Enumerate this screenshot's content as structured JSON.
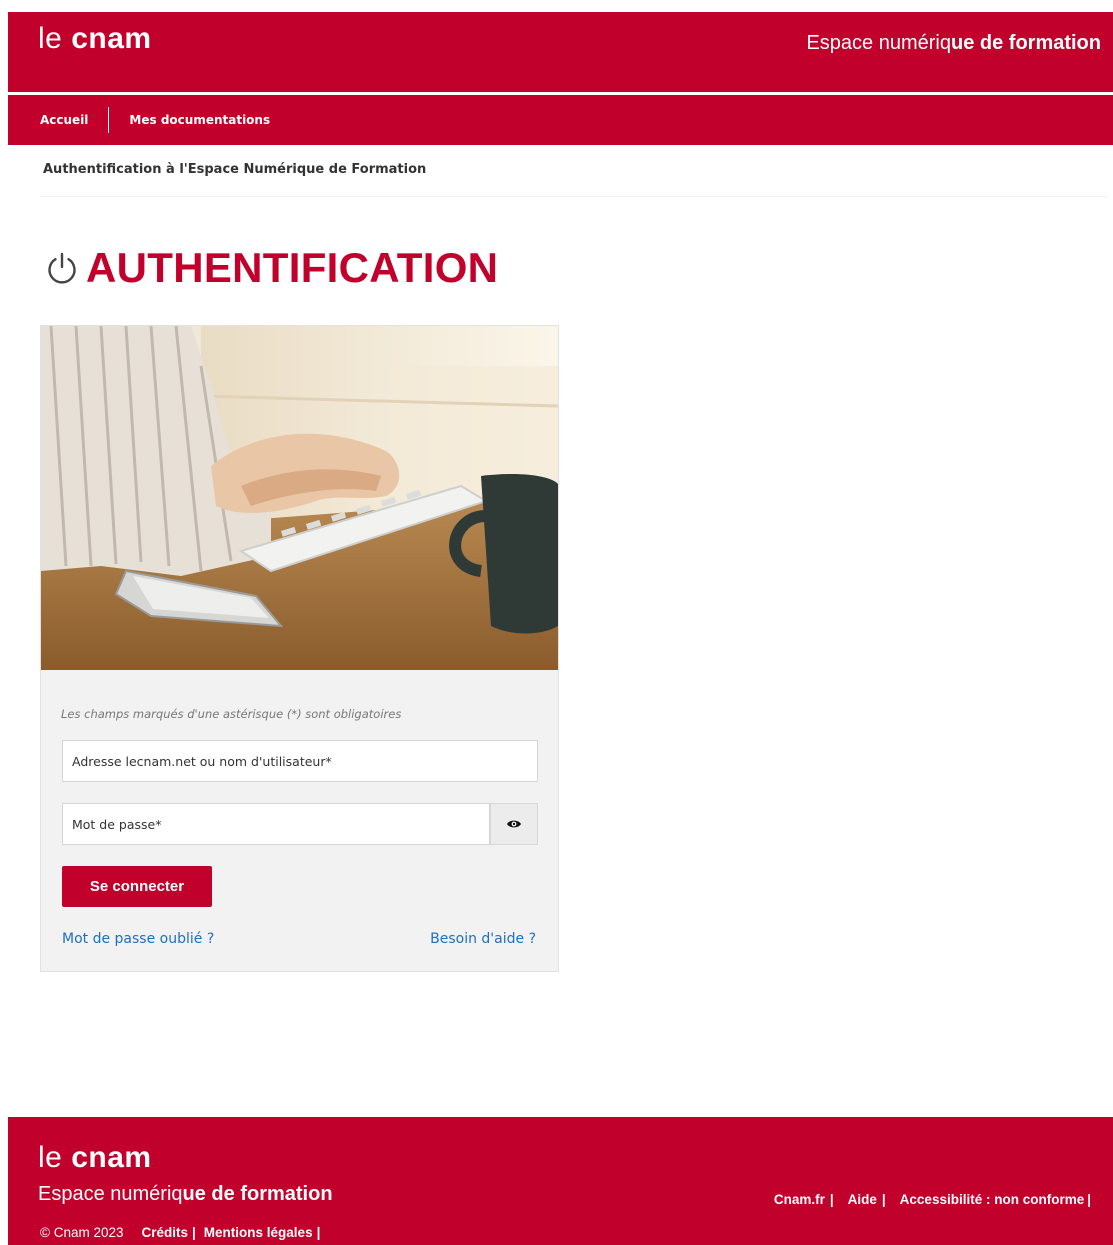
{
  "header": {
    "logo_le": "le",
    "logo_cnam": "cnam",
    "tagline_part1": "Espace numériq",
    "tagline_part2": "ue de formation"
  },
  "nav": {
    "items": [
      {
        "label": "Accueil"
      },
      {
        "label": "Mes documentations"
      }
    ]
  },
  "breadcrumb": "Authentification à l'Espace Numérique de Formation",
  "page_title": "AUTHENTIFICATION",
  "form": {
    "required_note": "Les champs marqués d'une astérisque (*) sont obligatoires",
    "username_placeholder": "Adresse lecnam.net ou nom d'utilisateur*",
    "username_value": "",
    "password_placeholder": "Mot de passe*",
    "password_value": "",
    "submit_label": "Se connecter",
    "forgot_label": "Mot de passe oublié ?",
    "help_label": "Besoin d'aide ?"
  },
  "footer": {
    "logo_le": "le",
    "logo_cnam": "cnam",
    "tagline_part1": "Espace numériq",
    "tagline_part2": "ue de formation",
    "copyright": "© Cnam 2023",
    "links_left": [
      {
        "label": "Crédits"
      },
      {
        "label": "Mentions légales"
      }
    ],
    "links_right": [
      {
        "label": "Cnam.fr"
      },
      {
        "label": "Aide"
      },
      {
        "label": "Accessibilité : non conforme"
      }
    ]
  },
  "icons": {
    "power": "power-icon",
    "eye": "eye-icon"
  },
  "colors": {
    "brand_red": "#c1002b",
    "link_blue": "#1f6fbf",
    "card_bg": "#f2f2f2"
  }
}
